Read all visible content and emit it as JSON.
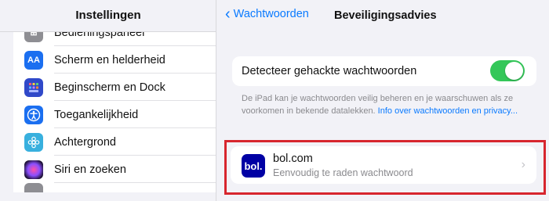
{
  "sidebar": {
    "title": "Instellingen",
    "items": [
      {
        "label": "Bedieningspaneel",
        "icon": "control-center-icon",
        "color": "#8e8e93",
        "glyph": "⊞"
      },
      {
        "label": "Scherm en helderheid",
        "icon": "display-brightness-icon",
        "color": "#1b6ff0",
        "glyph": "AA"
      },
      {
        "label": "Beginscherm en Dock",
        "icon": "home-screen-icon",
        "color": "#3049c9",
        "glyph": "▦"
      },
      {
        "label": "Toegankelijkheid",
        "icon": "accessibility-icon",
        "color": "#1b6ff0",
        "glyph": "♿"
      },
      {
        "label": "Achtergrond",
        "icon": "wallpaper-icon",
        "color": "#38b0de",
        "glyph": "✿"
      },
      {
        "label": "Siri en zoeken",
        "icon": "siri-icon",
        "color": "#2a1a3a",
        "glyph": "◉"
      }
    ]
  },
  "nav": {
    "back_label": "Wachtwoorden",
    "title": "Beveiligingsadvies"
  },
  "detect": {
    "label": "Detecteer gehackte wachtwoorden",
    "enabled": true,
    "footnote": "De iPad kan je wachtwoorden veilig beheren en je waarschuwen als ze voorkomen in bekende datalekken. ",
    "link": "Info over wachtwoorden en privacy..."
  },
  "password_item": {
    "logo_text": "bol.",
    "site": "bol.com",
    "description": "Eenvoudig te raden wachtwoord"
  },
  "colors": {
    "accent": "#0a7aff",
    "toggle_on": "#34c759",
    "highlight": "#d7262e",
    "bol_brand": "#0000a4"
  }
}
